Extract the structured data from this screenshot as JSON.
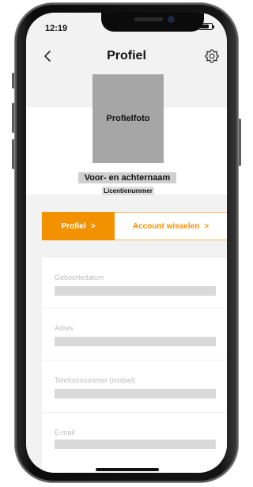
{
  "status_bar": {
    "time": "12:19"
  },
  "header": {
    "title": "Profiel",
    "back_icon": "chevron-left-icon",
    "settings_icon": "gear-icon"
  },
  "profile": {
    "photo_label": "Profielfoto",
    "name_label": "Voor- en achternaam",
    "license_label": "Licentienummer"
  },
  "tabs": [
    {
      "label": "Profiel",
      "chevron": ">",
      "active": true
    },
    {
      "label": "Account wisselen",
      "chevron": ">",
      "active": false
    }
  ],
  "fields": [
    {
      "label": "Geboortedatum"
    },
    {
      "label": "Adres"
    },
    {
      "label": "Telefoonnummer (mobiel)"
    },
    {
      "label": "E-mail"
    }
  ],
  "colors": {
    "accent": "#f39200",
    "placeholder": "#d9d9d9",
    "photo_placeholder": "#a6a6a6"
  }
}
